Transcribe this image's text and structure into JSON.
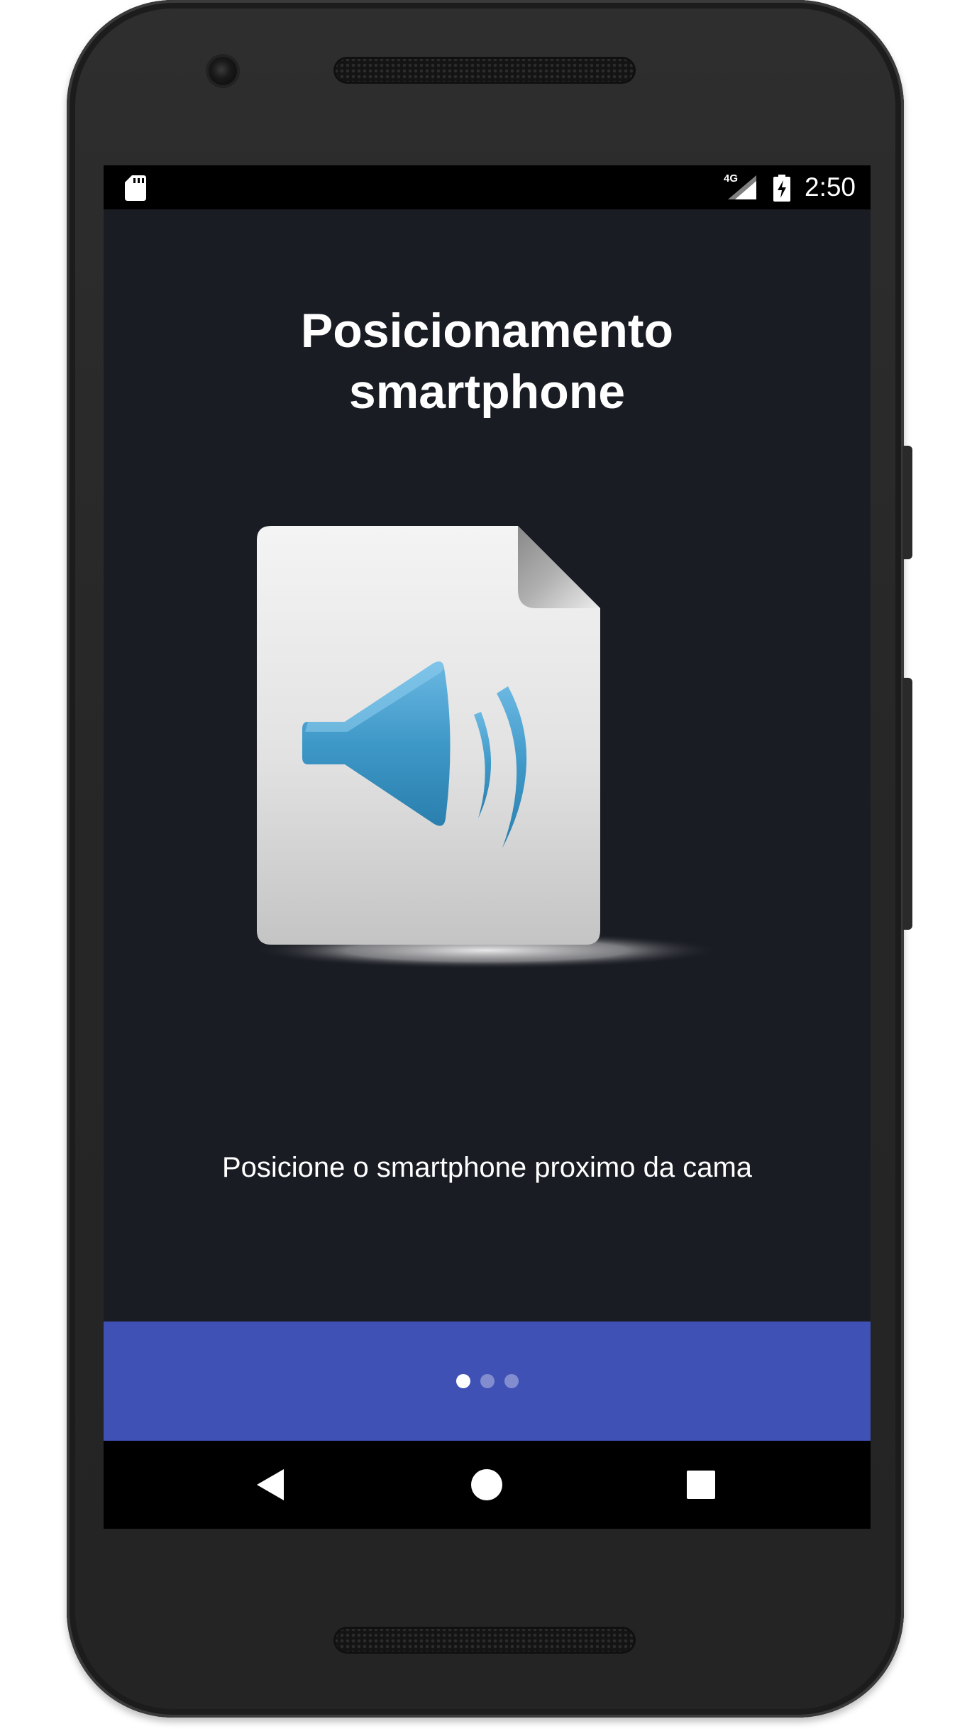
{
  "status_bar": {
    "network": "4G",
    "time": "2:50",
    "icons": [
      "sd-card-icon",
      "signal-icon",
      "battery-charging-icon"
    ]
  },
  "onboarding": {
    "title_line1": "Posicionamento",
    "title_line2": "smartphone",
    "illustration_icon": "audio-file-speaker-icon",
    "description": "Posicione o smartphone proximo da cama",
    "page_indicator": {
      "current": 1,
      "total": 3
    }
  },
  "colors": {
    "background": "#1a1c24",
    "indicator_bar": "#3f51b5",
    "speaker_blue": "#3a92c0"
  },
  "navigation_bar": {
    "icons": [
      "back-icon",
      "home-icon",
      "recents-icon"
    ]
  }
}
